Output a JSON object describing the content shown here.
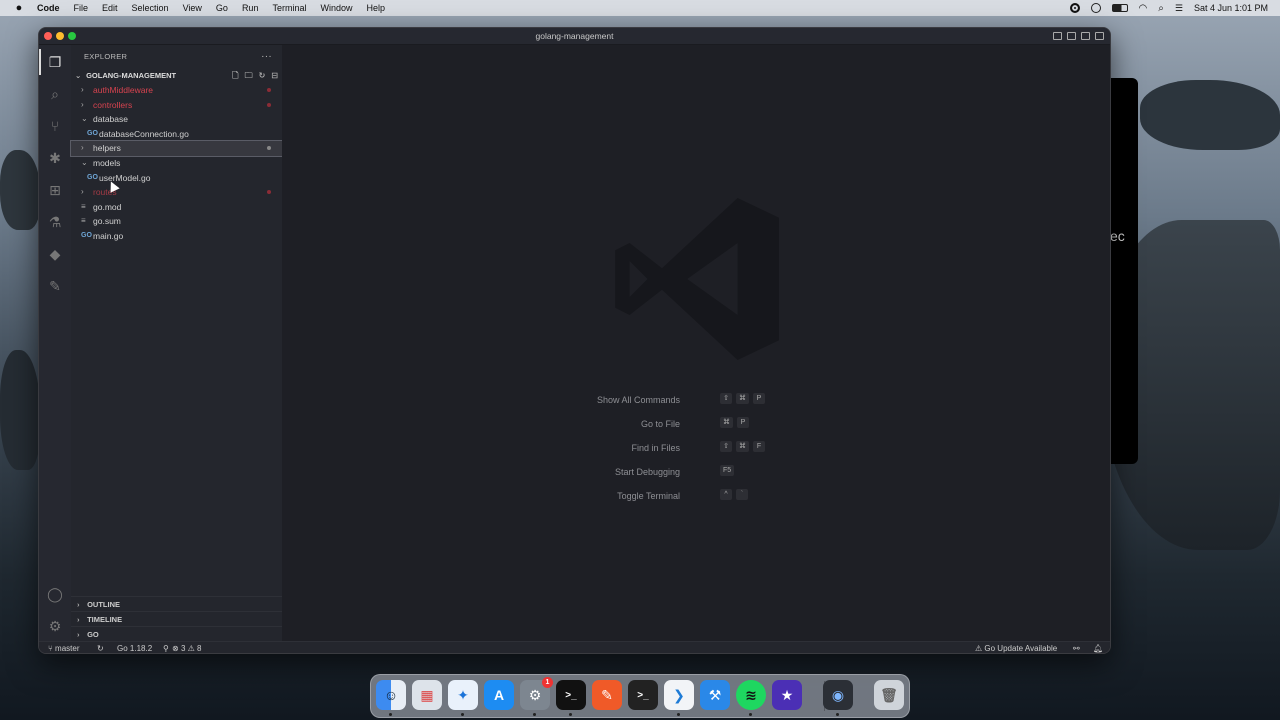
{
  "menubar": {
    "app": "Code",
    "items": [
      "File",
      "Edit",
      "Selection",
      "View",
      "Go",
      "Run",
      "Terminal",
      "Window",
      "Help"
    ],
    "clock": "Sat 4 Jun  1:01 PM"
  },
  "window": {
    "title": "golang-management"
  },
  "explorer": {
    "header": "EXPLORER",
    "project": "GOLANG-MANAGEMENT",
    "tree": [
      {
        "name": "authMiddleware",
        "type": "folder",
        "open": false,
        "status": "error"
      },
      {
        "name": "controllers",
        "type": "folder",
        "open": false,
        "status": "error"
      },
      {
        "name": "database",
        "type": "folder",
        "open": true,
        "status": ""
      },
      {
        "name": "databaseConnection.go",
        "type": "go",
        "status": ""
      },
      {
        "name": "helpers",
        "type": "folder",
        "open": false,
        "status": "modified",
        "selected": true
      },
      {
        "name": "models",
        "type": "folder",
        "open": true,
        "status": ""
      },
      {
        "name": "userModel.go",
        "type": "go",
        "status": ""
      },
      {
        "name": "routes",
        "type": "folder",
        "open": false,
        "status": "error"
      },
      {
        "name": "go.mod",
        "type": "file",
        "status": ""
      },
      {
        "name": "go.sum",
        "type": "file",
        "status": ""
      },
      {
        "name": "main.go",
        "type": "go",
        "status": ""
      }
    ],
    "sections": [
      "OUTLINE",
      "TIMELINE",
      "GO"
    ]
  },
  "welcome": {
    "hints": [
      {
        "label": "Show All Commands",
        "keys": [
          "⇧",
          "⌘",
          "P"
        ]
      },
      {
        "label": "Go to File",
        "keys": [
          "⌘",
          "P"
        ]
      },
      {
        "label": "Find in Files",
        "keys": [
          "⇧",
          "⌘",
          "F"
        ]
      },
      {
        "label": "Start Debugging",
        "keys": [
          "F5"
        ]
      },
      {
        "label": "Toggle Terminal",
        "keys": [
          "^",
          "`"
        ]
      }
    ]
  },
  "statusbar": {
    "branch": "master",
    "go_version": "Go 1.18.2",
    "errors": "3",
    "warnings": "8",
    "update": "Go Update Available"
  },
  "dock": {
    "apps": [
      "finder",
      "launchpad",
      "safari",
      "app-store",
      "system-preferences",
      "terminal",
      "pencil",
      "terminal-2",
      "vscode",
      "xcode",
      "spotify",
      "imovie",
      "quicktime",
      "trash"
    ],
    "system_preferences_badge": "1"
  },
  "desktop": {
    "background_window_text": "ec"
  },
  "colors": {
    "error": "#d7434f",
    "go": "#6fa6d6",
    "editor_bg": "#1e1f25",
    "sidebar_bg": "#24262d"
  }
}
